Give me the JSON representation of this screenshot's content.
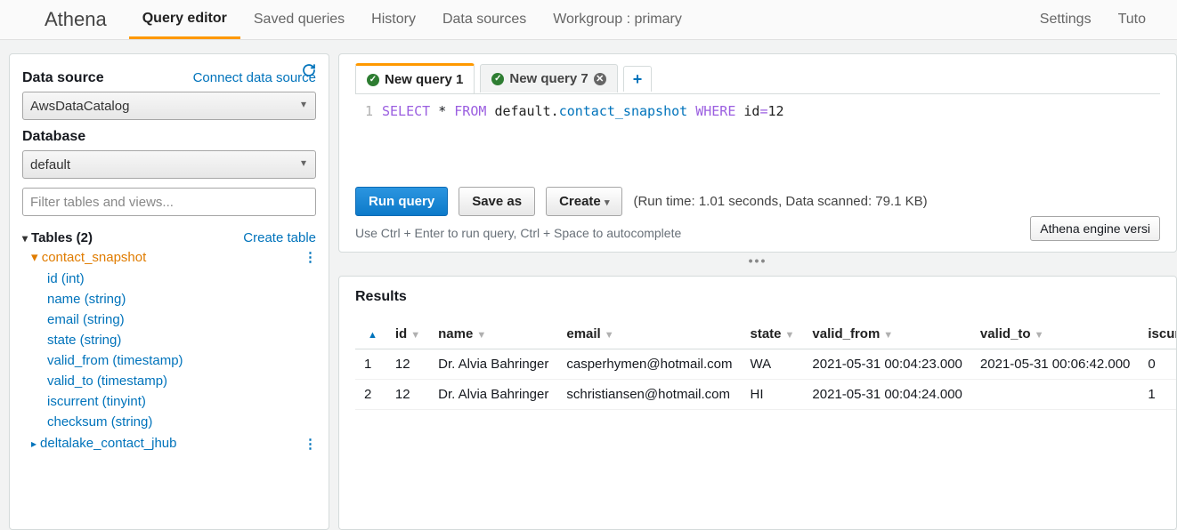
{
  "brand": "Athena",
  "nav": {
    "tabs": [
      "Query editor",
      "Saved queries",
      "History",
      "Data sources",
      "Workgroup : primary"
    ],
    "active": 0,
    "right": [
      "Settings",
      "Tuto"
    ]
  },
  "left": {
    "data_source_label": "Data source",
    "connect_link": "Connect data source",
    "data_source_value": "AwsDataCatalog",
    "database_label": "Database",
    "database_value": "default",
    "filter_placeholder": "Filter tables and views...",
    "tables_label": "Tables (2)",
    "create_table_link": "Create table",
    "tables": [
      {
        "name": "contact_snapshot",
        "expanded": true,
        "columns": [
          "id (int)",
          "name (string)",
          "email (string)",
          "state (string)",
          "valid_from (timestamp)",
          "valid_to (timestamp)",
          "iscurrent (tinyint)",
          "checksum (string)"
        ]
      },
      {
        "name": "deltalake_contact_jhub",
        "expanded": false
      }
    ]
  },
  "editor": {
    "tabs": [
      {
        "label": "New query 1",
        "status": "ok",
        "active": true,
        "closable": false
      },
      {
        "label": "New query 7",
        "status": "ok",
        "active": false,
        "closable": true
      }
    ],
    "line_no": "1",
    "sql": {
      "kw_select": "SELECT",
      "star": "*",
      "kw_from": "FROM",
      "db": "default",
      "tbl": "contact_snapshot",
      "kw_where": "WHERE",
      "col": "id",
      "eqval": "12"
    },
    "run_btn": "Run query",
    "save_btn": "Save as",
    "create_btn": "Create",
    "run_info": "(Run time: 1.01 seconds, Data scanned: 79.1 KB)",
    "hint": "Use Ctrl + Enter to run query, Ctrl + Space to autocomplete",
    "engine_pill": "Athena engine versi"
  },
  "results": {
    "title": "Results",
    "columns": [
      "",
      "id",
      "name",
      "email",
      "state",
      "valid_from",
      "valid_to",
      "iscurrent"
    ],
    "rows": [
      [
        "1",
        "12",
        "Dr. Alvia Bahringer",
        "casperhymen@hotmail.com",
        "WA",
        "2021-05-31 00:04:23.000",
        "2021-05-31 00:06:42.000",
        "0"
      ],
      [
        "2",
        "12",
        "Dr. Alvia Bahringer",
        "schristiansen@hotmail.com",
        "HI",
        "2021-05-31 00:04:24.000",
        "",
        "1"
      ]
    ]
  }
}
